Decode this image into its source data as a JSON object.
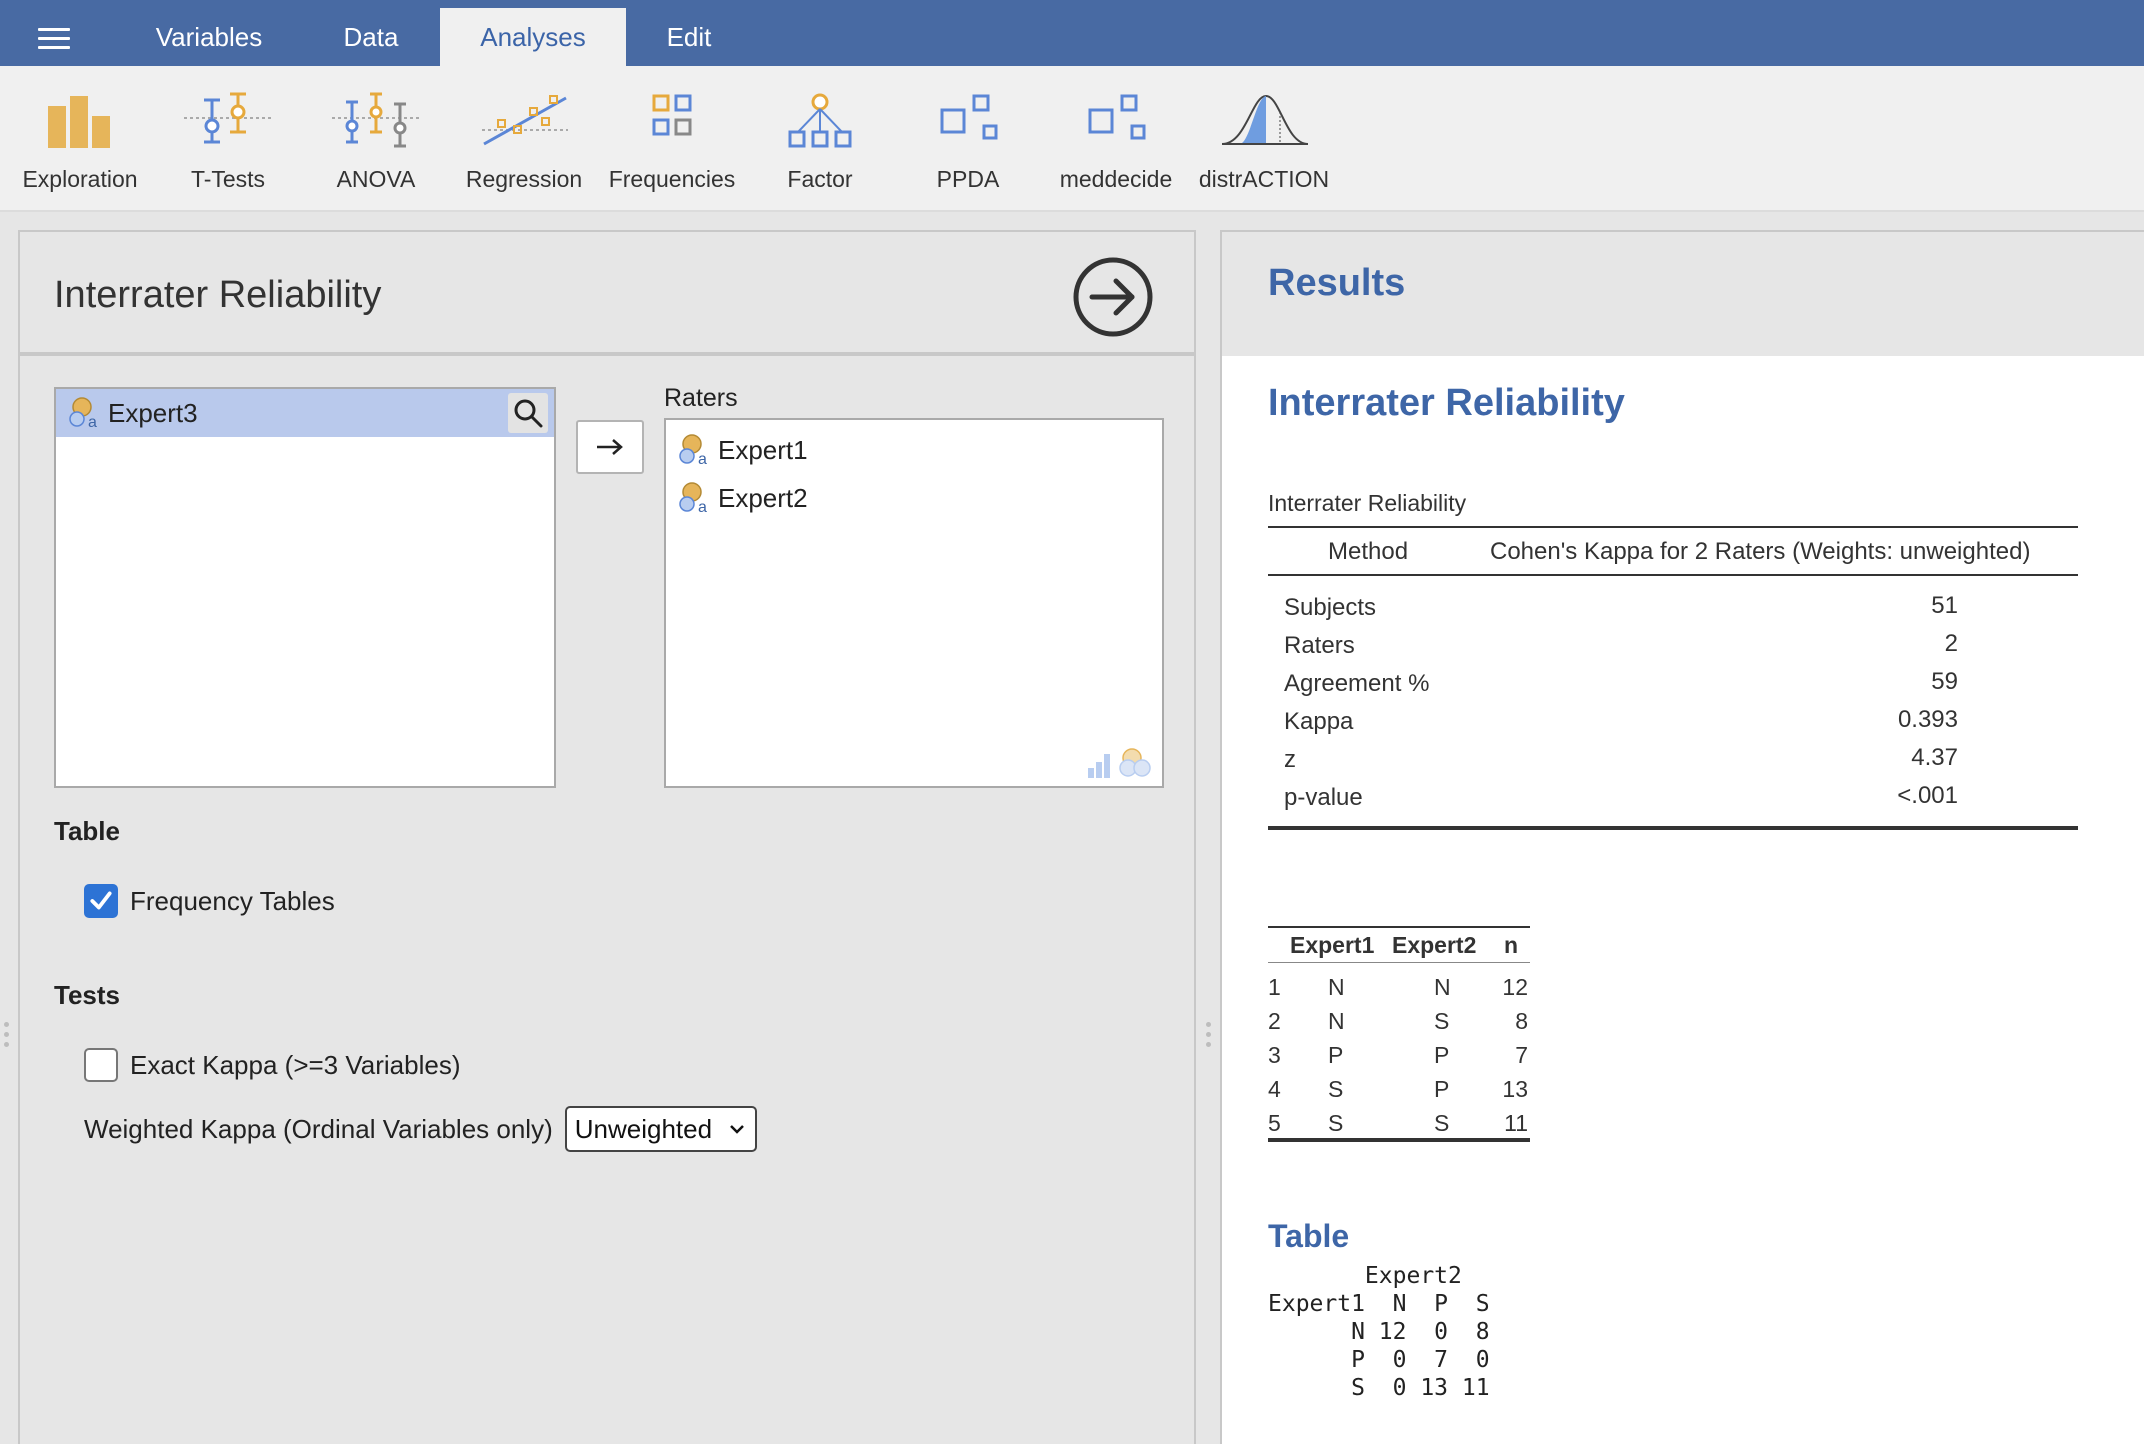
{
  "tabs": [
    "Variables",
    "Data",
    "Analyses",
    "Edit"
  ],
  "active_tab": "Analyses",
  "ribbon": [
    "Exploration",
    "T-Tests",
    "ANOVA",
    "Regression",
    "Frequencies",
    "Factor",
    "PPDA",
    "meddecide",
    "distrACTION"
  ],
  "left": {
    "title": "Interrater Reliability",
    "available_vars": [
      "Expert3"
    ],
    "raters_label": "Raters",
    "raters": [
      "Expert1",
      "Expert2"
    ],
    "section_table": "Table",
    "freq_tables_label": "Frequency Tables",
    "freq_tables_checked": true,
    "section_tests": "Tests",
    "exact_kappa_label": "Exact Kappa (>=3 Variables)",
    "exact_kappa_checked": false,
    "weighted_label": "Weighted Kappa (Ordinal Variables only)",
    "weighted_value": "Unweighted"
  },
  "results": {
    "header": "Results",
    "heading": "Interrater Reliability",
    "table_caption": "Interrater Reliability",
    "col_method": "Method",
    "col_kappa": "Cohen's Kappa for 2 Raters (Weights: unweighted)",
    "rows": [
      {
        "label": "Subjects",
        "value": "51"
      },
      {
        "label": "Raters",
        "value": "2"
      },
      {
        "label": "Agreement %",
        "value": "59"
      },
      {
        "label": "Kappa",
        "value": "0.393"
      },
      {
        "label": "z",
        "value": "4.37"
      },
      {
        "label": "p-value",
        "value": "<.001"
      }
    ],
    "freq_headers": [
      "Expert1",
      "Expert2",
      "n"
    ],
    "freq_rows": [
      [
        "1",
        "N",
        "N",
        "12"
      ],
      [
        "2",
        "N",
        "S",
        "8"
      ],
      [
        "3",
        "P",
        "P",
        "7"
      ],
      [
        "4",
        "S",
        "P",
        "13"
      ],
      [
        "5",
        "S",
        "S",
        "11"
      ]
    ],
    "table_heading": "Table",
    "crosstab": "       Expert2\nExpert1  N  P  S\n      N 12  0  8\n      P  0  7  0\n      S  0 13 11"
  }
}
